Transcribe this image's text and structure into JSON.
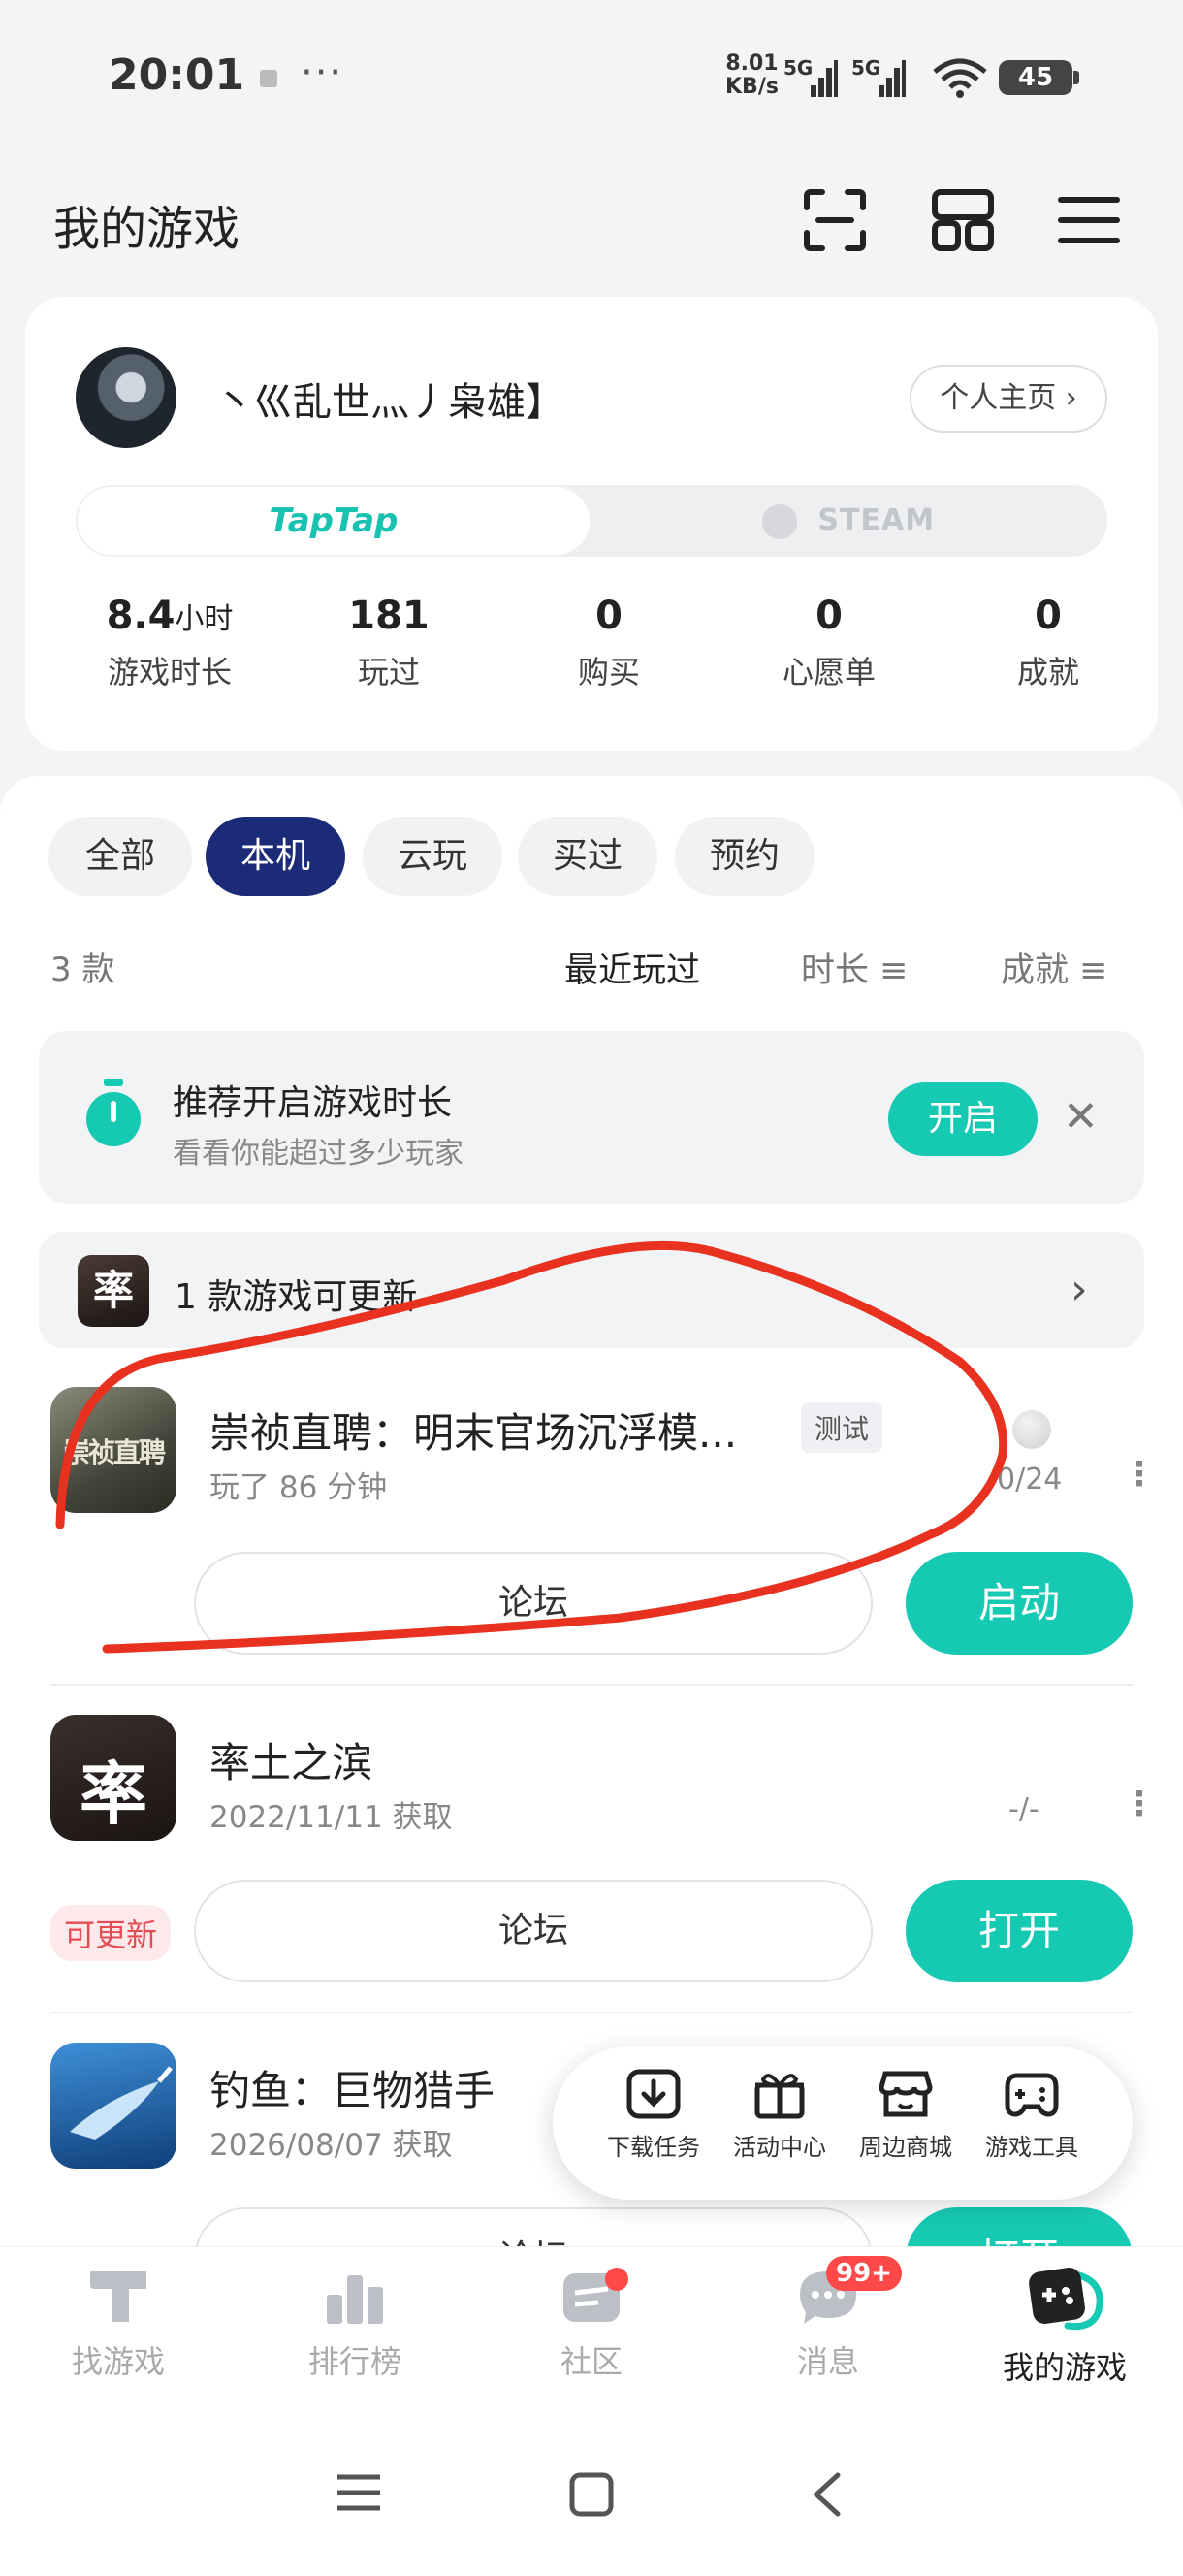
{
  "status_bar": {
    "time": "20:01",
    "more": "···",
    "net_speed_value": "8.01",
    "net_speed_unit": "KB/s",
    "sim1": "5G",
    "sim2": "5G",
    "battery": "45"
  },
  "header": {
    "title": "我的游戏",
    "icons": [
      "scan-icon",
      "grid-layout-icon",
      "menu-icon"
    ]
  },
  "profile": {
    "username": "丶巛乱世灬丿枭雄】",
    "home_button": "个人主页",
    "platform_tabs": {
      "taptap": "TapTap",
      "steam": "STEAM",
      "active": "TapTap"
    },
    "stats": [
      {
        "value": "8.4",
        "unit": "小时",
        "label": "游戏时长"
      },
      {
        "value": "181",
        "unit": "",
        "label": "玩过"
      },
      {
        "value": "0",
        "unit": "",
        "label": "购买"
      },
      {
        "value": "0",
        "unit": "",
        "label": "心愿单"
      },
      {
        "value": "0",
        "unit": "",
        "label": "成就"
      }
    ]
  },
  "filters": {
    "chips": [
      "全部",
      "本机",
      "云玩",
      "买过",
      "预约"
    ],
    "active": "本机"
  },
  "sort": {
    "count": "3 款",
    "options": [
      "最近玩过",
      "时长",
      "成就"
    ],
    "active": "最近玩过"
  },
  "promo": {
    "title": "推荐开启游戏时长",
    "subtitle": "看看你能超过多少玩家",
    "button": "开启"
  },
  "update_banner": {
    "icon_char": "率",
    "text": "1 款游戏可更新"
  },
  "games": [
    {
      "name": "崇祯直聘：明末官场沉浮模...",
      "tag": "测试",
      "subtitle": "玩了 86 分钟",
      "achievement": "0/24",
      "forum": "论坛",
      "action": "启动",
      "icon_text": "崇祯直聘"
    },
    {
      "name": "率土之滨",
      "subtitle": "2022/11/11 获取",
      "achievement": "-/-",
      "update_badge": "可更新",
      "forum": "论坛",
      "action": "打开",
      "icon_text": "率"
    },
    {
      "name": "钓鱼：巨物猎手",
      "subtitle": "2026/08/07 获取",
      "forum": "论坛",
      "action": "打开"
    }
  ],
  "quick_menu": [
    {
      "label": "下载任务",
      "icon": "download-icon"
    },
    {
      "label": "活动中心",
      "icon": "gift-icon"
    },
    {
      "label": "周边商城",
      "icon": "shop-icon"
    },
    {
      "label": "游戏工具",
      "icon": "gamepad-icon"
    }
  ],
  "tabbar": [
    {
      "label": "找游戏",
      "icon": "taptap-logo-icon"
    },
    {
      "label": "排行榜",
      "icon": "ranking-icon"
    },
    {
      "label": "社区",
      "icon": "community-icon"
    },
    {
      "label": "消息",
      "icon": "message-icon",
      "badge": "99+"
    },
    {
      "label": "我的游戏",
      "icon": "my-games-icon",
      "active": true
    }
  ],
  "colors": {
    "accent": "#16c9b3",
    "active_chip": "#1c2b78",
    "annotation_stroke": "#e8311f",
    "badge": "#ff4949"
  }
}
